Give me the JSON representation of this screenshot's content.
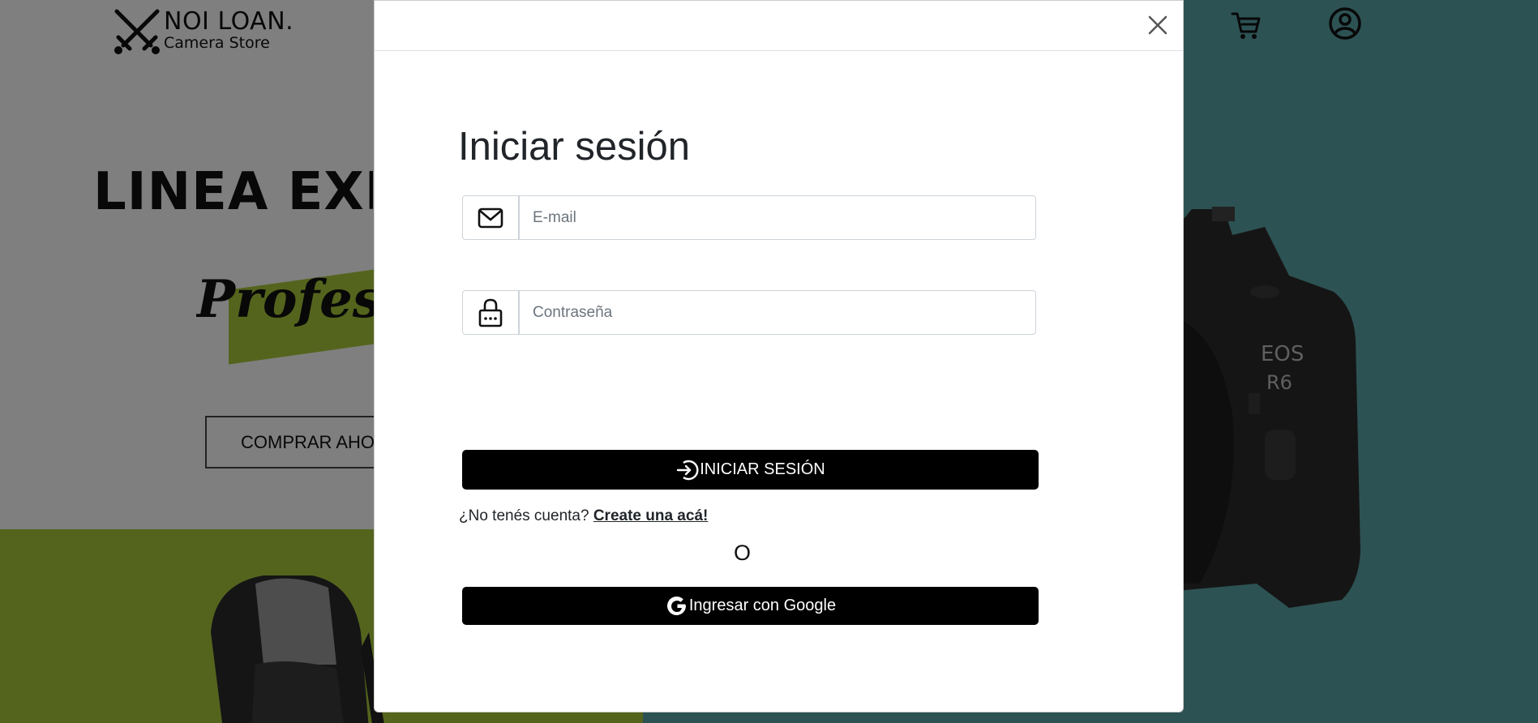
{
  "background": {
    "logo": {
      "title": "NOI LOAN.",
      "subtitle": "Camera Store",
      "icon": "crossed-swords-icon"
    },
    "nav": {
      "cart_icon": "cart-icon",
      "user_icon": "user-circle-icon"
    },
    "hero": {
      "heading": "LINEA EXPERT",
      "script": "Professional",
      "cta_label": "COMPRAR AHORA",
      "camera_model": "EOS",
      "camera_model_2": "R6"
    },
    "colors": {
      "teal": "#5aa4a6",
      "lime": "#a9c93a",
      "overlay": "rgba(0,0,0,0.5)"
    }
  },
  "modal": {
    "close_icon": "close-icon",
    "title": "Iniciar sesión",
    "email": {
      "placeholder": "E-mail",
      "value": "",
      "icon": "envelope-icon"
    },
    "password": {
      "placeholder": "Contraseña",
      "value": "",
      "icon": "lock-icon"
    },
    "login_button": {
      "label": "INICIAR SESIÓN",
      "icon": "login-arrow-icon"
    },
    "signup": {
      "prompt": "¿No tenés cuenta?",
      "link": "Create una acá!"
    },
    "separator": "O",
    "google_button": {
      "label": "Ingresar con Google",
      "icon": "google-icon"
    }
  }
}
